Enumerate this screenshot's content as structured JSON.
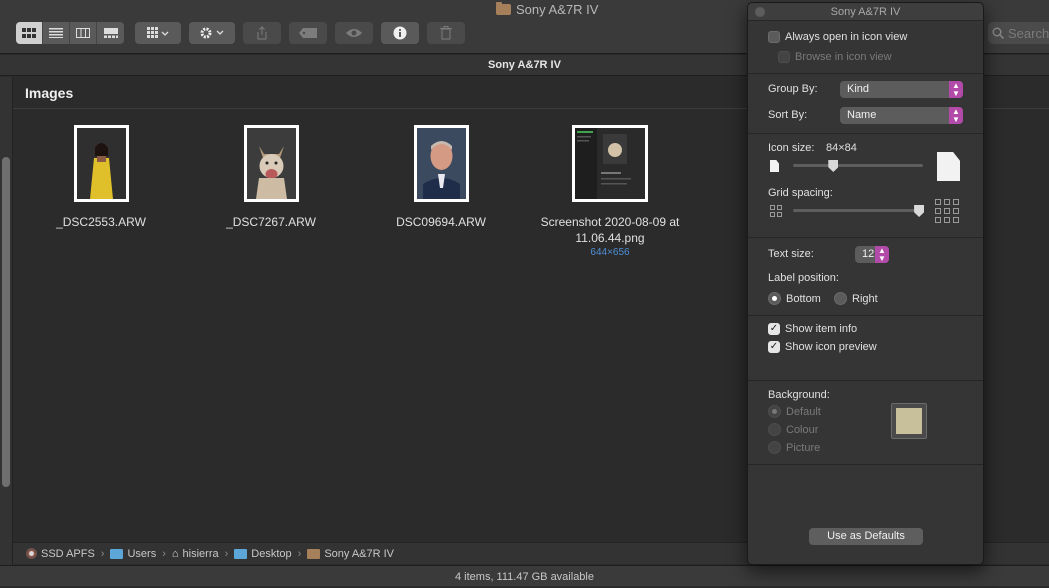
{
  "window": {
    "title": "Sony A&7R IV",
    "path_title": "Sony A&7R IV"
  },
  "toolbar": {
    "view_modes": [
      "icon-view",
      "list-view",
      "column-view",
      "gallery-view"
    ],
    "search_placeholder": "Search"
  },
  "main": {
    "section_title": "Images",
    "items": [
      {
        "name": "_DSC2553.ARW",
        "info": ""
      },
      {
        "name": "_DSC7267.ARW",
        "info": ""
      },
      {
        "name": "DSC09694.ARW",
        "info": ""
      },
      {
        "name": "Screenshot 2020-08-09 at 11.06.44.png",
        "info": "644×656"
      }
    ]
  },
  "breadcrumb": [
    {
      "label": "SSD APFS",
      "icon": "disk-icon"
    },
    {
      "label": "Users",
      "icon": "folder-icon"
    },
    {
      "label": "hisierra",
      "icon": "home-icon"
    },
    {
      "label": "Desktop",
      "icon": "folder-icon"
    },
    {
      "label": "Sony A&7R IV",
      "icon": "folder-icon"
    }
  ],
  "status": "4 items, 111.47 GB available",
  "view_options": {
    "title": "Sony A&7R IV",
    "always_open_icon_view": "Always open in icon view",
    "browse_icon_view": "Browse in icon view",
    "group_by_label": "Group By:",
    "group_by_value": "Kind",
    "sort_by_label": "Sort By:",
    "sort_by_value": "Name",
    "icon_size_label": "Icon size:",
    "icon_size_value": "84×84",
    "icon_size_level": 0.31,
    "grid_spacing_label": "Grid spacing:",
    "grid_spacing_level": 0.97,
    "text_size_label": "Text size:",
    "text_size_value": "12",
    "label_position_label": "Label position:",
    "label_bottom": "Bottom",
    "label_right": "Right",
    "show_item_info": "Show item info",
    "show_icon_preview": "Show icon preview",
    "background_label": "Background:",
    "bg_default": "Default",
    "bg_colour": "Colour",
    "bg_picture": "Picture",
    "use_as_defaults": "Use as Defaults"
  }
}
